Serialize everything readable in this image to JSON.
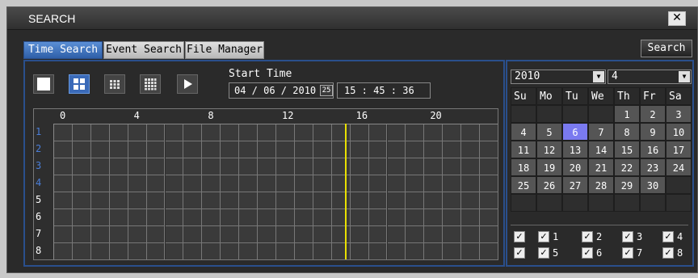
{
  "window": {
    "title": "SEARCH",
    "close_glyph": "✕"
  },
  "tabs": [
    {
      "label": "Time Search",
      "active": true
    },
    {
      "label": "Event Search",
      "active": false
    },
    {
      "label": "File Manager",
      "active": false
    }
  ],
  "search_button": "Search",
  "toolbar": {
    "buttons": [
      {
        "icon": "single-view-icon"
      },
      {
        "icon": "quad-view-icon"
      },
      {
        "icon": "nine-view-icon"
      },
      {
        "icon": "sixteen-view-icon"
      },
      {
        "icon": "play-icon"
      }
    ]
  },
  "start_time": {
    "label": "Start Time",
    "date": "04 / 06 / 2010",
    "calendar_glyph": "25",
    "time": "15 : 45 : 36"
  },
  "timeline": {
    "hour_labels": [
      "0",
      "4",
      "8",
      "12",
      "16",
      "20"
    ],
    "channels": [
      "1",
      "2",
      "3",
      "4",
      "5",
      "6",
      "7",
      "8"
    ],
    "marker_hour": 15.76
  },
  "calendar": {
    "year": "2010",
    "month": "4",
    "weekdays": [
      "Su",
      "Mo",
      "Tu",
      "We",
      "Th",
      "Fr",
      "Sa"
    ],
    "days": [
      [
        "",
        "",
        "",
        "",
        "1",
        "2",
        "3"
      ],
      [
        "4",
        "5",
        "6",
        "7",
        "8",
        "9",
        "10"
      ],
      [
        "11",
        "12",
        "13",
        "14",
        "15",
        "16",
        "17"
      ],
      [
        "18",
        "19",
        "20",
        "21",
        "22",
        "23",
        "24"
      ],
      [
        "25",
        "26",
        "27",
        "28",
        "29",
        "30",
        ""
      ],
      [
        "",
        "",
        "",
        "",
        "",
        "",
        ""
      ]
    ],
    "selected_day": "6"
  },
  "channel_checks": {
    "row1": [
      {
        "label": ""
      },
      {
        "label": "1"
      },
      {
        "label": "2"
      },
      {
        "label": "3"
      },
      {
        "label": "4"
      }
    ],
    "row2": [
      {
        "label": ""
      },
      {
        "label": "5"
      },
      {
        "label": "6"
      },
      {
        "label": "7"
      },
      {
        "label": "8"
      }
    ]
  },
  "colors": {
    "accent": "#2a4f8c",
    "selected_day": "#7a7af0",
    "marker": "#e8e000"
  }
}
